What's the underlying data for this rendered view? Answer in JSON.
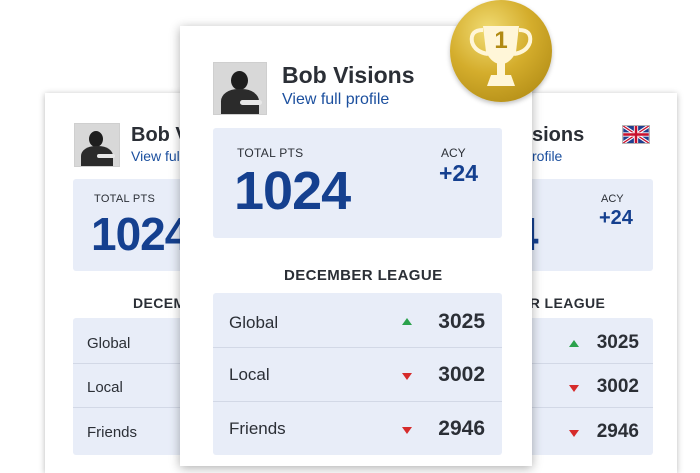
{
  "profile": {
    "name": "Bob Visions",
    "name_back_left": "Bob V",
    "name_back_right": "sions",
    "view_profile": "View full profile",
    "view_profile_back_left": "View ful",
    "view_profile_back_right": "rofile"
  },
  "stats": {
    "total_pts_label": "TOTAL PTS",
    "total_pts_value": "1024",
    "total_pts_back_left": "1024",
    "total_pts_back_right": "4",
    "acy_label": "ACY",
    "acy_value": "+24"
  },
  "league": {
    "title": "DECEMBER LEAGUE",
    "title_back_left": "DECEM",
    "title_back_right": "ER LEAGUE",
    "rows": [
      {
        "label": "Global",
        "value": "3025",
        "trend": "up"
      },
      {
        "label": "Local",
        "value": "3002",
        "trend": "down"
      },
      {
        "label": "Friends",
        "value": "2946",
        "trend": "down"
      }
    ]
  },
  "medal": {
    "rank": "1",
    "icon": "trophy-icon"
  },
  "colors": {
    "accent": "#15408f",
    "link": "#1b4f9e",
    "panel": "#e8edf8",
    "up": "#2ba24c",
    "down": "#d62b2b",
    "gold": "#d4ad2c"
  }
}
